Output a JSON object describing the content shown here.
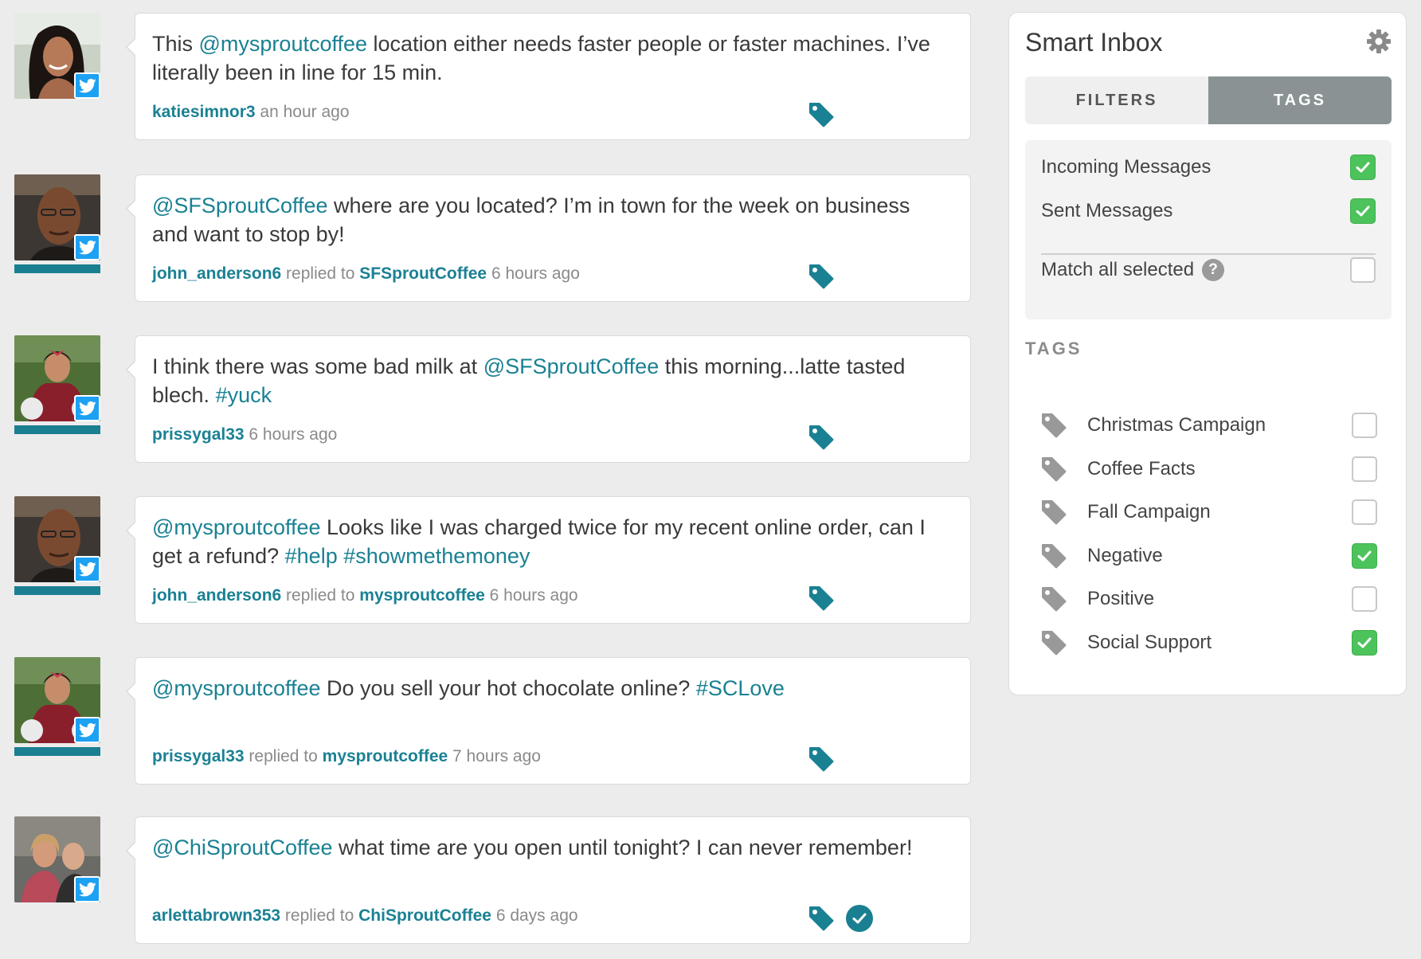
{
  "colors": {
    "accent": "#1a8193",
    "twitter": "#1da1f2",
    "check_green": "#4dc35b",
    "tab_active": "#8a9294"
  },
  "messages": [
    {
      "text": [
        {
          "t": "This ",
          "hl": false
        },
        {
          "t": "@mysproutcoffee",
          "hl": true
        },
        {
          "t": " location either needs faster people or faster machines. I’ve literally been in line for 15 min.",
          "hl": false
        }
      ],
      "user": "katiesimnor3",
      "replied_label": "",
      "replied_to": "",
      "time": "an hour ago",
      "avatar": "woman",
      "bar": false,
      "done": false
    },
    {
      "text": [
        {
          "t": "@SFSproutCoffee",
          "hl": true
        },
        {
          "t": " where are you located? I’m in town for the week on business and want to stop by!",
          "hl": false
        }
      ],
      "user": "john_anderson6",
      "replied_label": "replied to",
      "replied_to": "SFSproutCoffee",
      "time": "6 hours ago",
      "avatar": "man",
      "bar": true,
      "done": false
    },
    {
      "text": [
        {
          "t": "I think there was some bad milk at ",
          "hl": false
        },
        {
          "t": "@SFSproutCoffee",
          "hl": true
        },
        {
          "t": " this morning...latte tasted blech. ",
          "hl": false
        },
        {
          "t": "#yuck",
          "hl": true
        }
      ],
      "user": "prissygal33",
      "replied_label": "",
      "replied_to": "",
      "time": "6 hours ago",
      "avatar": "girl",
      "bar": true,
      "done": false
    },
    {
      "text": [
        {
          "t": "@mysproutcoffee",
          "hl": true
        },
        {
          "t": " Looks like I was charged twice for my recent online order, can I get a refund? ",
          "hl": false
        },
        {
          "t": "#help",
          "hl": true
        },
        {
          "t": " ",
          "hl": false
        },
        {
          "t": "#showmethemoney",
          "hl": true
        }
      ],
      "user": "john_anderson6",
      "replied_label": "replied to",
      "replied_to": "mysproutcoffee",
      "time": "6 hours ago",
      "avatar": "man",
      "bar": true,
      "done": false
    },
    {
      "text": [
        {
          "t": "@mysproutcoffee",
          "hl": true
        },
        {
          "t": " Do you sell your hot chocolate online? ",
          "hl": false
        },
        {
          "t": "#SCLove",
          "hl": true
        }
      ],
      "user": "prissygal33",
      "replied_label": "replied to",
      "replied_to": "mysproutcoffee",
      "time": "7 hours ago",
      "avatar": "girl",
      "bar": true,
      "done": false
    },
    {
      "text": [
        {
          "t": "@ChiSproutCoffee",
          "hl": true
        },
        {
          "t": " what time are you open until tonight? I can never remember!",
          "hl": false
        }
      ],
      "user": "arlettabrown353",
      "replied_label": "replied to",
      "replied_to": "ChiSproutCoffee",
      "time": "6 days ago",
      "avatar": "couple",
      "bar": false,
      "done": true
    }
  ],
  "panel": {
    "title": "Smart Inbox",
    "tabs": [
      {
        "label": "FILTERS",
        "active": false
      },
      {
        "label": "TAGS",
        "active": true
      }
    ],
    "options": [
      {
        "label": "Incoming Messages",
        "checked": true
      },
      {
        "label": "Sent Messages",
        "checked": true
      }
    ],
    "match_all": {
      "label": "Match all selected",
      "help": "?",
      "checked": false
    },
    "tags_heading": "TAGS",
    "tags": [
      {
        "label": "Christmas Campaign",
        "checked": false
      },
      {
        "label": "Coffee Facts",
        "checked": false
      },
      {
        "label": "Fall Campaign",
        "checked": false
      },
      {
        "label": "Negative",
        "checked": true
      },
      {
        "label": "Positive",
        "checked": false
      },
      {
        "label": "Social Support",
        "checked": true
      }
    ]
  }
}
